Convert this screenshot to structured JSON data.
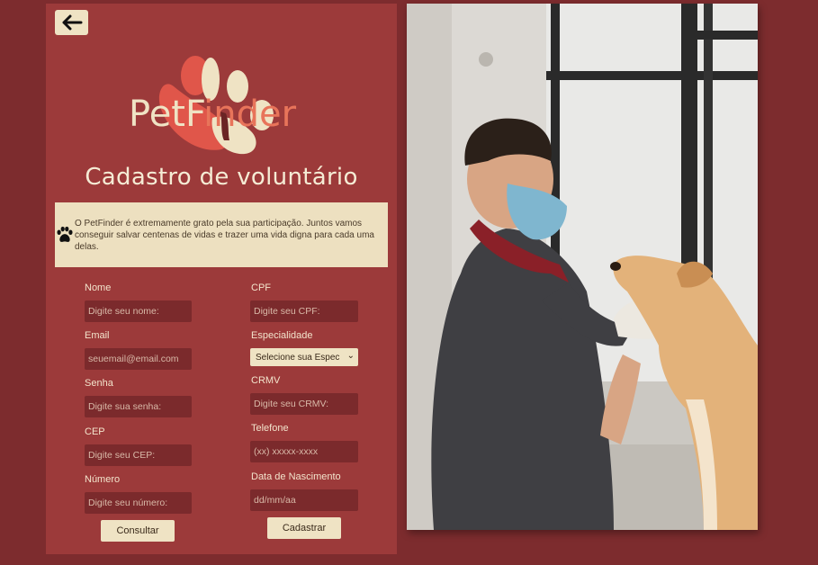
{
  "header": {
    "back_label": "←"
  },
  "logo": {
    "text_start": "PetF",
    "text_accent": "i",
    "text_end": "nder"
  },
  "page_title": "Cadastro de voluntário",
  "notice": {
    "icon": "paw-icon",
    "text": "O PetFinder é extremamente grato pela sua participação. Juntos vamos conseguir salvar centenas de vidas e trazer uma vida digna para cada uma delas."
  },
  "form": {
    "nome": {
      "label": "Nome",
      "placeholder": "Digite seu nome:"
    },
    "email": {
      "label": "Email",
      "placeholder": "seuemail@email.com"
    },
    "senha": {
      "label": "Senha",
      "placeholder": "Digite sua senha:"
    },
    "cep": {
      "label": "CEP",
      "placeholder": "Digite seu CEP:"
    },
    "numero": {
      "label": "Número",
      "placeholder": "Digite seu número:"
    },
    "cpf": {
      "label": "CPF",
      "placeholder": "Digite seu CPF:"
    },
    "especialidade": {
      "label": "Especialidade",
      "selected": "Selecione sua Espec"
    },
    "crmv": {
      "label": "CRMV",
      "placeholder": "Digite seu CRMV:"
    },
    "telefone": {
      "label": "Telefone",
      "placeholder": "(xx) xxxxx-xxxx"
    },
    "nascimento": {
      "label": "Data de Nascimento",
      "placeholder": "dd/mm/aa"
    },
    "consultar_label": "Consultar",
    "cadastrar_label": "Cadastrar"
  },
  "colors": {
    "background": "#7d2c2e",
    "panel": "#9c3a3a",
    "cream": "#efe3c4",
    "input": "#7b2a2c",
    "accent": "#e8745a"
  }
}
